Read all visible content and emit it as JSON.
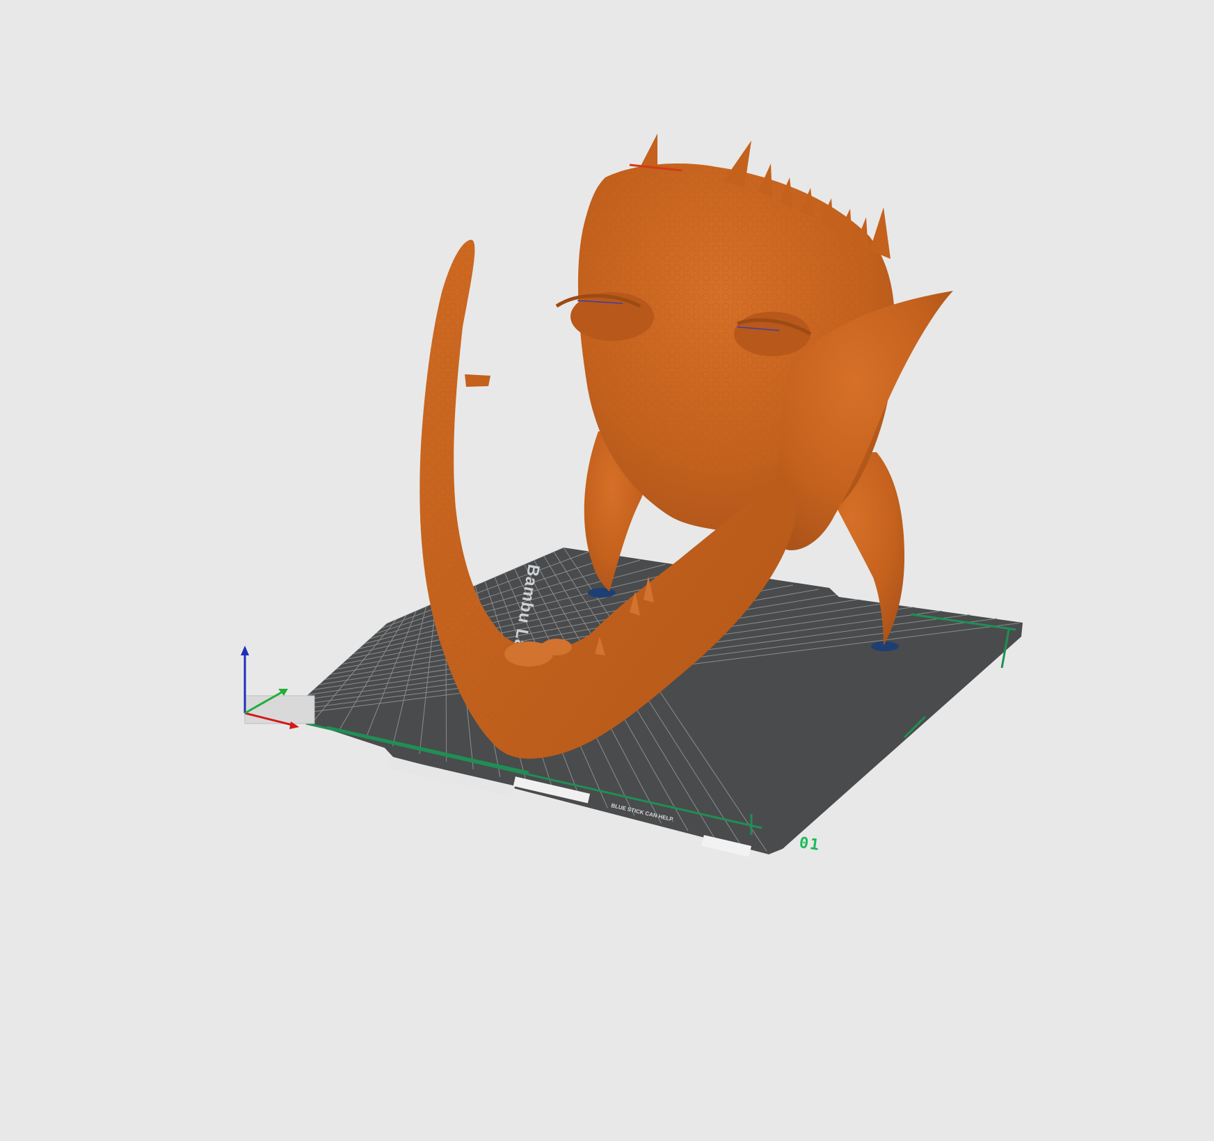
{
  "app": {
    "view": "3D prepare viewport"
  },
  "build_plate": {
    "plate_number": "01",
    "brand_text": "Bambu Lab",
    "note_text": "BLUE STICK CAN HELP.",
    "colors": {
      "plate": "#4a4b4c",
      "grid": "#8b8d8f",
      "accent": "#1f8f55",
      "background": "#e8e8e8"
    }
  },
  "model": {
    "name": "dragon-head-model",
    "color": "#c4611d",
    "shadow_color": "#9c4b14",
    "support_marker_color": "#1e3f73"
  },
  "axes": {
    "x_color": "#d11b1b",
    "y_color": "#1fae3a",
    "z_color": "#1f2fb8"
  }
}
